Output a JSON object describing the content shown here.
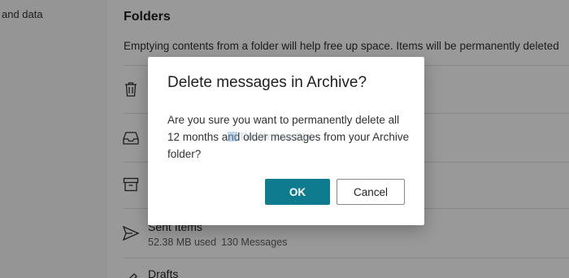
{
  "nav": {
    "item_label": "and data"
  },
  "folders": {
    "title": "Folders",
    "description": "Emptying contents from a folder will help free up space. Items will be permanently deleted",
    "items": [
      {
        "icon": "trash-icon",
        "name": "",
        "size": "",
        "count": ""
      },
      {
        "icon": "inbox-icon",
        "name": "",
        "size": "",
        "count": ""
      },
      {
        "icon": "archive-icon",
        "name": "",
        "size": "",
        "count": ""
      },
      {
        "icon": "send-icon",
        "name": "Sent Items",
        "size": "52.38 MB used",
        "count": "130 Messages"
      },
      {
        "icon": "pencil-icon",
        "name": "Drafts",
        "size": "",
        "count": ""
      }
    ]
  },
  "dialog": {
    "title": "Delete messages in Archive?",
    "body": "Are you sure you want to permanently delete all 12 months and older messages from your Archive folder?",
    "watermark": "TheWindowsClub",
    "ok_label": "OK",
    "cancel_label": "Cancel"
  },
  "colors": {
    "primary_button": "#0f7b8f",
    "overlay": "rgba(0,0,0,0.40)"
  }
}
